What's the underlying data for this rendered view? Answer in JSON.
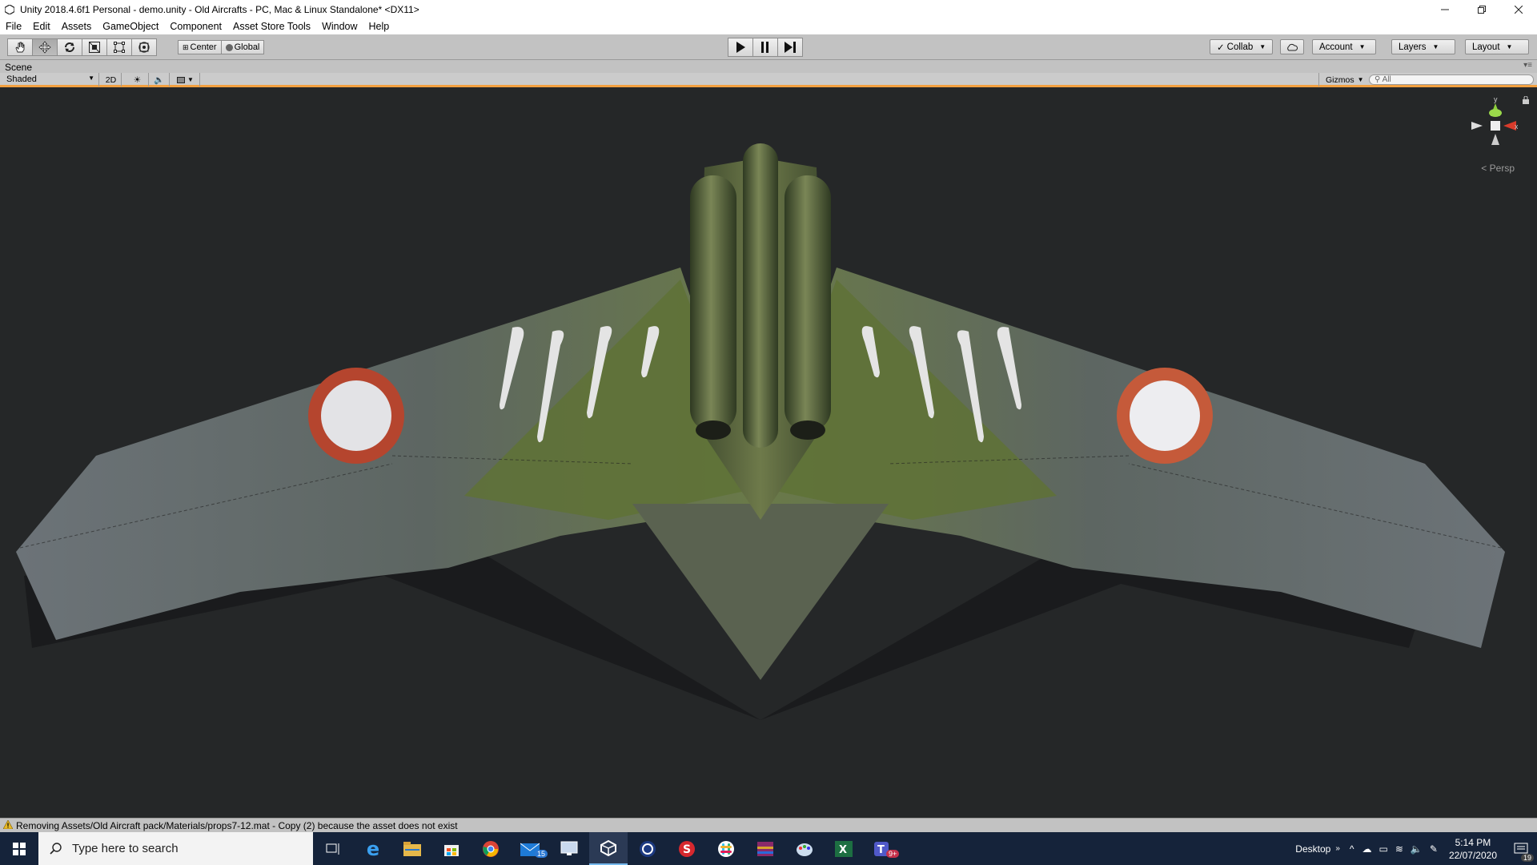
{
  "window": {
    "title": "Unity 2018.4.6f1 Personal - demo.unity - Old Aircrafts - PC, Mac & Linux Standalone* <DX11>",
    "controls": [
      "minimize",
      "restore",
      "close"
    ]
  },
  "menu": [
    "File",
    "Edit",
    "Assets",
    "GameObject",
    "Component",
    "Asset Store Tools",
    "Window",
    "Help"
  ],
  "toolbar": {
    "tools": [
      "hand-tool",
      "move-tool",
      "rotate-tool",
      "scale-tool",
      "rect-tool",
      "transform-tool"
    ],
    "active_tool": "move-tool",
    "pivot_mode": "Center",
    "pivot_space": "Global",
    "collab": "Collab",
    "account": "Account",
    "layers": "Layers",
    "layout": "Layout"
  },
  "scene": {
    "tab_label": "Scene",
    "draw_mode": "Shaded",
    "mode_2d": "2D",
    "gizmos": "Gizmos",
    "search_placeholder": "All",
    "projection": "Persp",
    "gizmo_axes": {
      "y": "y",
      "x": "x"
    }
  },
  "status": {
    "message": "Removing Assets/Old Aircraft pack/Materials/props7-12.mat - Copy (2) because the asset does not exist"
  },
  "taskbar": {
    "search_placeholder": "Type here to search",
    "apps": [
      "task-view-icon",
      "edge-icon",
      "file-explorer-icon",
      "store-icon",
      "chrome-icon",
      "mail-icon",
      "remote-desktop-icon",
      "unity-icon",
      "cinema4d-icon",
      "substance-icon",
      "slack-icon",
      "winrar-icon",
      "paint-icon",
      "excel-icon",
      "teams-icon"
    ],
    "mail_badge": "15",
    "teams_badge": "9+",
    "desktop_label": "Desktop",
    "time": "5:14 PM",
    "date": "22/07/2020",
    "notification_count": "19"
  },
  "colors": {
    "viewport_bg": "#252728",
    "scene_accent": "#f2a040",
    "taskbar_bg": "#15233a"
  }
}
